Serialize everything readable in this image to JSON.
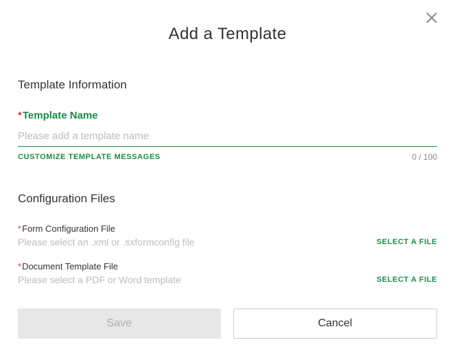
{
  "dialog": {
    "title": "Add a Template"
  },
  "templateInfo": {
    "heading": "Template Information",
    "nameLabel": "Template Name",
    "namePlaceholder": "Please add a template name",
    "nameValue": "",
    "customizeLink": "CUSTOMIZE TEMPLATE MESSAGES",
    "counter": "0 / 100"
  },
  "configFiles": {
    "heading": "Configuration Files",
    "formConfig": {
      "label": "Form Configuration File",
      "placeholder": "Please select an .xml or .sxformconfig file",
      "button": "SELECT A FILE"
    },
    "docTemplate": {
      "label": "Document Template File",
      "placeholder": "Please select a PDF or Word template",
      "button": "SELECT A FILE"
    }
  },
  "footer": {
    "save": "Save",
    "cancel": "Cancel"
  },
  "colors": {
    "accent": "#1a8a4a",
    "required": "#d43a3a"
  }
}
